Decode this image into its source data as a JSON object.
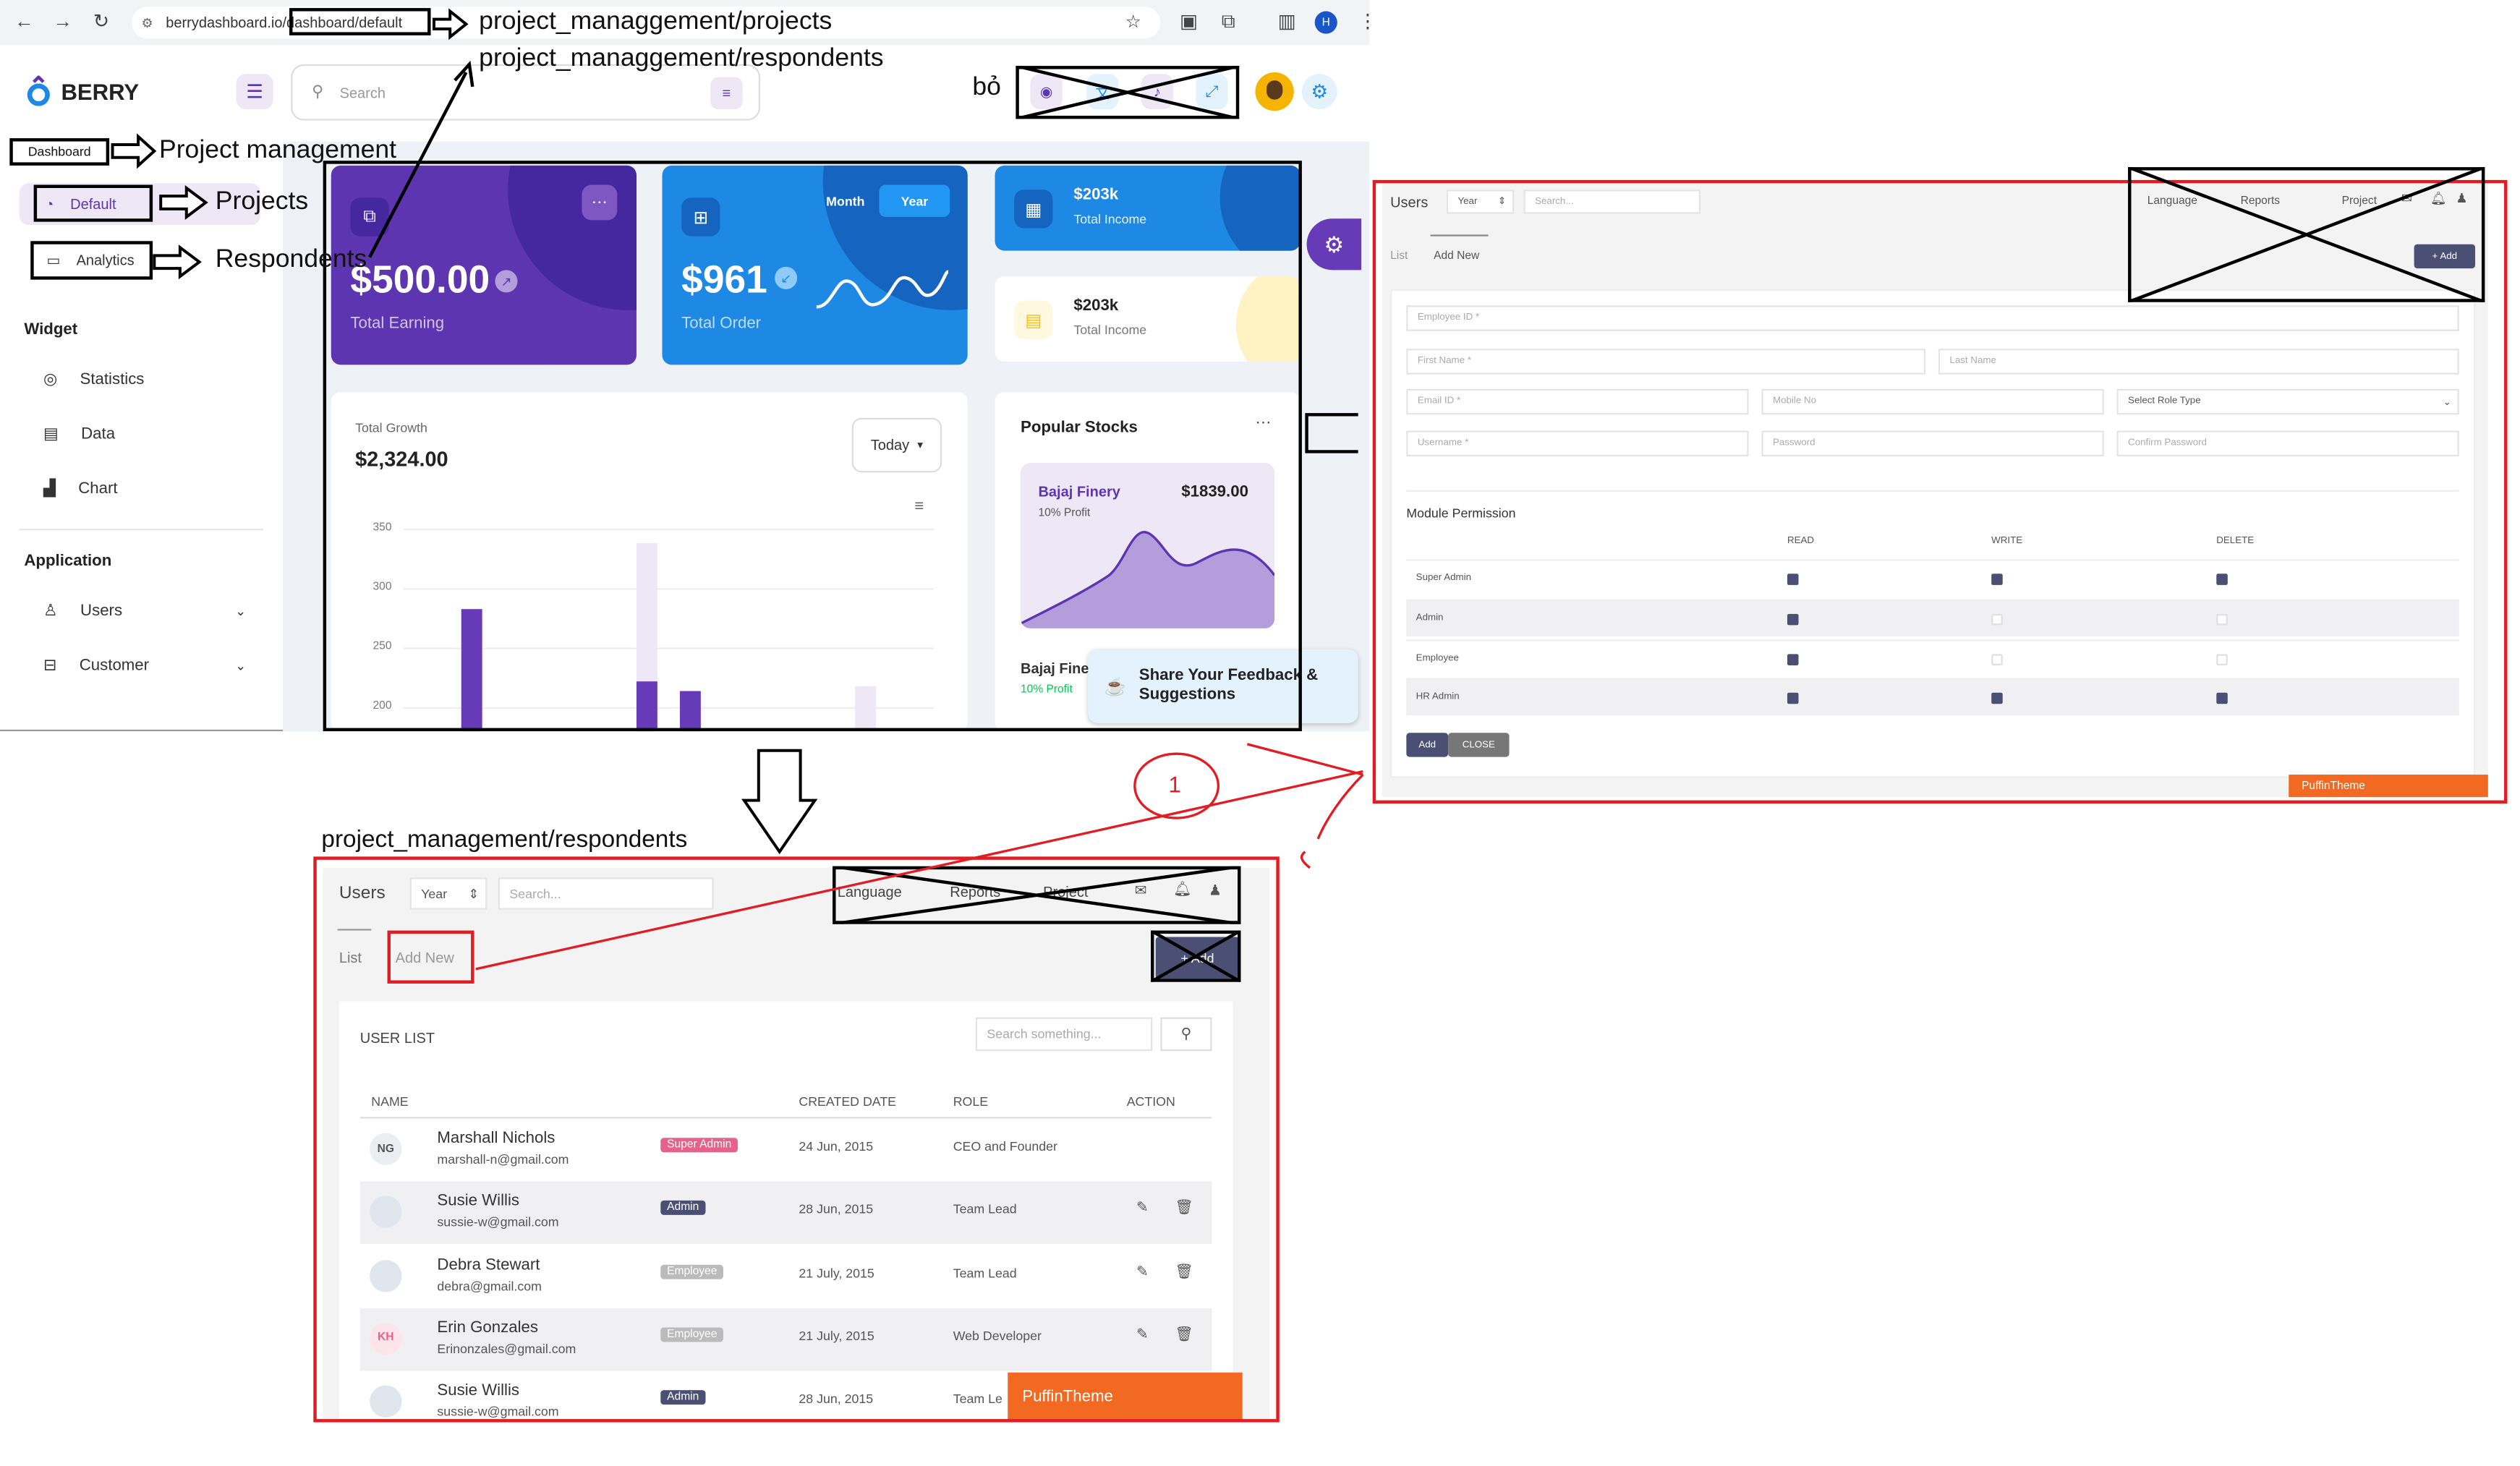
{
  "browser": {
    "url": "berrydashboard.io/dashboard/default",
    "avatar_letter": "H"
  },
  "annotations": {
    "projects_path": "project_managgement/projects",
    "respondents_path": "project_managgement/respondents",
    "remove_note": "bỏ",
    "project_management": "Project management",
    "projects": "Projects",
    "respondents": "Respondents",
    "bottom_path": "project_management/respondents",
    "step_number": "1"
  },
  "berry": {
    "brand": "BERRY",
    "search_placeholder": "Search",
    "nav": {
      "dashboard": "Dashboard",
      "default": "Default",
      "analytics": "Analytics",
      "widget": "Widget",
      "statistics": "Statistics",
      "data": "Data",
      "chart": "Chart",
      "application": "Application",
      "users": "Users",
      "customer": "Customer"
    },
    "earning": {
      "value": "$500.00",
      "label": "Total Earning"
    },
    "order": {
      "value": "$961",
      "label": "Total Order",
      "tab_month": "Month",
      "tab_year": "Year"
    },
    "income1": {
      "value": "$203k",
      "label": "Total Income"
    },
    "income2": {
      "value": "$203k",
      "label": "Total Income"
    },
    "growth": {
      "label": "Total Growth",
      "value": "$2,324.00",
      "period": "Today",
      "ticks": [
        "350",
        "300",
        "250",
        "200"
      ]
    },
    "stocks": {
      "title": "Popular Stocks",
      "item_name": "Bajaj Finery",
      "item_value": "$1839.00",
      "item_profit": "10% Profit",
      "item2_name": "Bajaj Finer",
      "item2_profit": "10% Profit"
    },
    "feedback": "Share Your Feedback & Suggestions"
  },
  "users_top": {
    "title": "Users",
    "year": "Year",
    "search_placeholder": "Search...",
    "language": "Language",
    "reports": "Reports",
    "project": "Project",
    "tab_list": "List",
    "tab_add_new": "Add New",
    "add_button": "+ Add",
    "fields": {
      "employee_id": "Employee ID *",
      "first_name": "First Name *",
      "last_name": "Last Name",
      "email_id": "Email ID *",
      "mobile_no": "Mobile No",
      "role_type": "Select Role Type",
      "username": "Username *",
      "password": "Password",
      "confirm_password": "Confirm Password"
    },
    "module_permission": "Module Permission",
    "columns": [
      "READ",
      "WRITE",
      "DELETE"
    ],
    "roles": [
      {
        "name": "Super Admin",
        "read": true,
        "write": true,
        "delete": true
      },
      {
        "name": "Admin",
        "read": true,
        "write": false,
        "delete": false
      },
      {
        "name": "Employee",
        "read": true,
        "write": false,
        "delete": false
      },
      {
        "name": "HR Admin",
        "read": true,
        "write": true,
        "delete": true
      }
    ],
    "btn_add": "Add",
    "btn_close": "CLOSE",
    "brand_bar": "PuffinTheme"
  },
  "users_bottom": {
    "title": "Users",
    "year": "Year",
    "search_placeholder": "Search...",
    "language": "Language",
    "reports": "Reports",
    "project": "Project",
    "tab_list": "List",
    "tab_add_new": "Add New",
    "add_button": "+ Add",
    "list_title": "USER LIST",
    "list_search": "Search something...",
    "headers": [
      "NAME",
      "CREATED DATE",
      "ROLE",
      "ACTION"
    ],
    "rows": [
      {
        "initials": "NG",
        "name": "Marshall Nichols",
        "email": "marshall-n@gmail.com",
        "badge": "Super Admin",
        "date": "24 Jun, 2015",
        "role": "CEO and Founder"
      },
      {
        "initials": "",
        "name": "Susie Willis",
        "email": "sussie-w@gmail.com",
        "badge": "Admin",
        "date": "28 Jun, 2015",
        "role": "Team Lead"
      },
      {
        "initials": "",
        "name": "Debra Stewart",
        "email": "debra@gmail.com",
        "badge": "Employee",
        "date": "21 July, 2015",
        "role": "Team Lead"
      },
      {
        "initials": "KH",
        "name": "Erin Gonzales",
        "email": "Erinonzales@gmail.com",
        "badge": "Employee",
        "date": "21 July, 2015",
        "role": "Web Developer"
      },
      {
        "initials": "",
        "name": "Susie Willis",
        "email": "sussie-w@gmail.com",
        "badge": "Admin",
        "date": "28 Jun, 2015",
        "role": "Team Le"
      }
    ],
    "brand_bar": "PuffinTheme"
  },
  "colors": {
    "purple": "#5e35b1",
    "blue": "#1e88e5",
    "red": "#e31b23",
    "orange": "#f26a21",
    "navy": "#4b4f74"
  }
}
